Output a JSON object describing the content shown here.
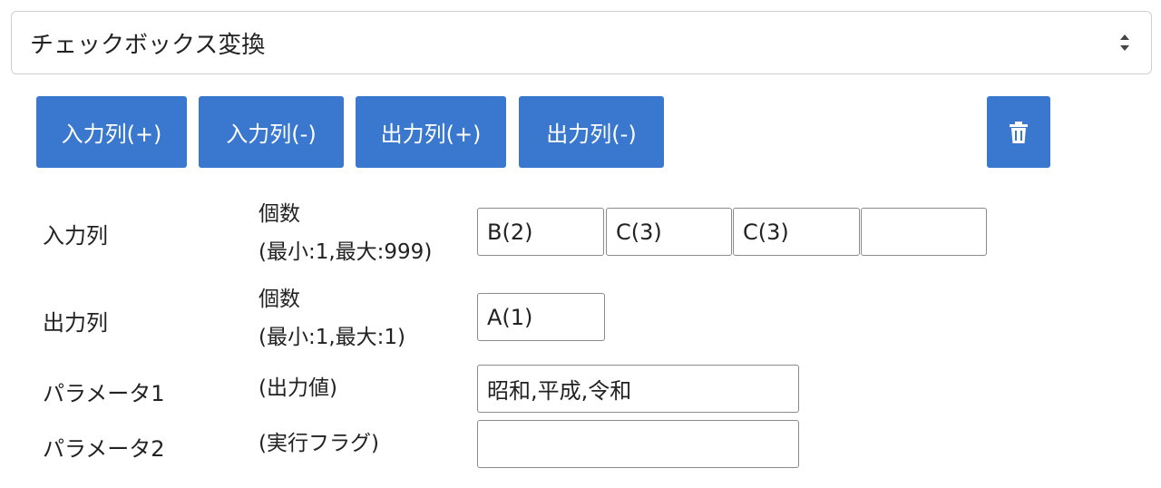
{
  "select": {
    "value": "チェックボックス変換",
    "icon": "sort-caret-icon"
  },
  "toolbar": {
    "input_plus": "入力列(+)",
    "input_minus": "入力列(-)",
    "output_plus": "出力列(+)",
    "output_minus": "出力列(-)",
    "delete_icon": "trash-icon",
    "accent": "#3a78d0"
  },
  "input_row": {
    "label": "入力列",
    "count_label": "個数",
    "count_range": "(最小:1,最大:999)",
    "cells": [
      "B(2)",
      "C(3)",
      "C(3)",
      ""
    ]
  },
  "output_row": {
    "label": "出力列",
    "count_label": "個数",
    "count_range": "(最小:1,最大:1)",
    "cells": [
      "A(1)"
    ]
  },
  "param1": {
    "label": "パラメータ1",
    "desc": "(出力値)",
    "value": "昭和,平成,令和"
  },
  "param2": {
    "label": "パラメータ2",
    "desc": "(実行フラグ)",
    "value": ""
  }
}
